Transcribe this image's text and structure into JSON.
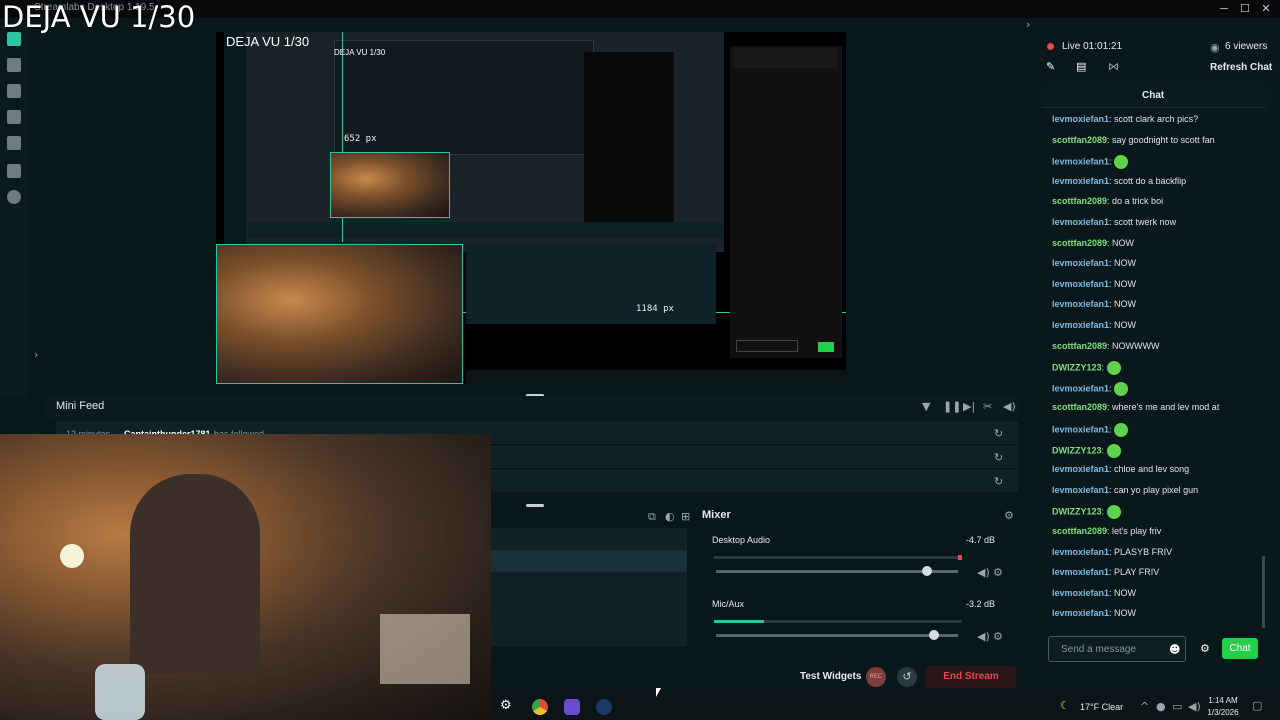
{
  "window": {
    "title": "Streamlabs Desktop 1.19.5",
    "overlay_text": "DEJA VU 1/30"
  },
  "preview": {
    "overlay_text": "DEJA VU 1/30",
    "overlay_text_small": "DEJA VU 1/30",
    "width_label": "652 px",
    "width_label_2": "1184 px"
  },
  "minifeed": {
    "title": "Mini Feed",
    "rows": [
      {
        "time": "12 minutes",
        "user": "Captainthunder1781",
        "event": "has followed"
      }
    ]
  },
  "mixer": {
    "title": "Mixer",
    "channels": [
      {
        "name": "Desktop Audio",
        "db": "-4.7 dB",
        "meter": 0.0,
        "volume": 0.87
      },
      {
        "name": "Mic/Aux",
        "db": "-3.2 dB",
        "meter": 0.2,
        "volume": 0.9
      }
    ]
  },
  "stream_bar": {
    "test_widgets": "Test Widgets",
    "rec_label": "REC",
    "end_stream": "End Stream"
  },
  "live": {
    "status": "Live 01:01:21",
    "viewers": "6 viewers",
    "refresh_label": "Refresh Chat"
  },
  "chat": {
    "title": "Chat",
    "placeholder": "Send a message",
    "send_label": "Chat",
    "messages": [
      {
        "user": "levmoxiefan1",
        "text": "scott clark arch pics?",
        "kind": "text"
      },
      {
        "user": "scottfan2089",
        "text": "say goodnight to scott fan",
        "kind": "text"
      },
      {
        "user": "levmoxiefan1",
        "text": "",
        "kind": "emote"
      },
      {
        "user": "levmoxiefan1",
        "text": "scott do a backflip",
        "kind": "text"
      },
      {
        "user": "scottfan2089",
        "text": "do a trick boi",
        "kind": "text"
      },
      {
        "user": "levmoxiefan1",
        "text": "scott twerk now",
        "kind": "text"
      },
      {
        "user": "scottfan2089",
        "text": "NOW",
        "kind": "text"
      },
      {
        "user": "levmoxiefan1",
        "text": "NOW",
        "kind": "text"
      },
      {
        "user": "levmoxiefan1",
        "text": "NOW",
        "kind": "text"
      },
      {
        "user": "levmoxiefan1",
        "text": "NOW",
        "kind": "text"
      },
      {
        "user": "levmoxiefan1",
        "text": "NOW",
        "kind": "text"
      },
      {
        "user": "scottfan2089",
        "text": "NOWWWW",
        "kind": "text"
      },
      {
        "user": "DWIZZY123",
        "text": "",
        "kind": "emote"
      },
      {
        "user": "levmoxiefan1",
        "text": "",
        "kind": "emote"
      },
      {
        "user": "scottfan2089",
        "text": "where's me and lev mod at",
        "kind": "text"
      },
      {
        "user": "levmoxiefan1",
        "text": "",
        "kind": "emote"
      },
      {
        "user": "DWIZZY123",
        "text": "",
        "kind": "emote"
      },
      {
        "user": "levmoxiefan1",
        "text": "chloe and lev song",
        "kind": "text"
      },
      {
        "user": "levmoxiefan1",
        "text": "can yo play pixel gun",
        "kind": "text"
      },
      {
        "user": "DWIZZY123",
        "text": "",
        "kind": "emote"
      },
      {
        "user": "scottfan2089",
        "text": "let's play friv",
        "kind": "text"
      },
      {
        "user": "levmoxiefan1",
        "text": "PLASYB FRIV",
        "kind": "text"
      },
      {
        "user": "levmoxiefan1",
        "text": "PLAY FRIV",
        "kind": "text"
      },
      {
        "user": "levmoxiefan1",
        "text": "NOW",
        "kind": "text"
      },
      {
        "user": "levmoxiefan1",
        "text": "NOW",
        "kind": "text"
      }
    ]
  },
  "taskbar": {
    "weather": "17°F  Clear",
    "time": "1:14 AM",
    "date": "1/3/2026"
  },
  "colors": {
    "accent": "#31c3a2",
    "chat_send": "#24d04a",
    "end_stream": "#e04a4a",
    "live_dot": "#e04a4a"
  }
}
